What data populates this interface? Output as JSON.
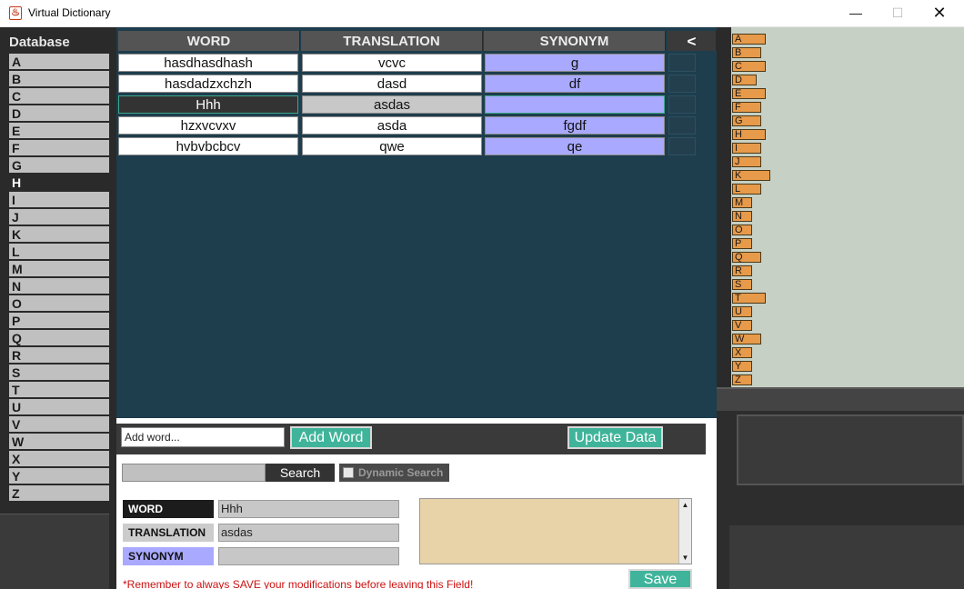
{
  "window": {
    "title": "Virtual Dictionary",
    "min": "—",
    "max": "☐",
    "close": "✕"
  },
  "database": {
    "header": "Database",
    "letters": [
      "A",
      "B",
      "C",
      "D",
      "E",
      "F",
      "G",
      "H",
      "I",
      "J",
      "K",
      "L",
      "M",
      "N",
      "O",
      "P",
      "Q",
      "R",
      "S",
      "T",
      "U",
      "V",
      "W",
      "X",
      "Y",
      "Z"
    ],
    "active_letter": "H"
  },
  "table": {
    "columns": [
      "WORD",
      "TRANSLATION",
      "SYNONYM"
    ],
    "back_label": "<",
    "rows": [
      {
        "word": "hasdhasdhash",
        "translation": "vcvc",
        "synonym": "g"
      },
      {
        "word": "hasdadzxchzh",
        "translation": "dasd",
        "synonym": "df"
      },
      {
        "word": "Hhh",
        "translation": "asdas",
        "synonym": ""
      },
      {
        "word": "hzxvcvxv",
        "translation": "asda",
        "synonym": "fgdf"
      },
      {
        "word": "hvbvbcbcv",
        "translation": "qwe",
        "synonym": "qe"
      }
    ],
    "selected_row": 2
  },
  "add_word": {
    "placeholder": "Add word...",
    "button": "Add Word",
    "update_button": "Update Data"
  },
  "search": {
    "value": "",
    "button": "Search",
    "dynamic_label": "Dynamic Search",
    "dynamic_checked": false
  },
  "detail": {
    "word_label": "WORD",
    "word_value": "Hhh",
    "translation_label": "TRANSLATION",
    "translation_value": "asdas",
    "synonym_label": "SYNONYM",
    "synonym_value": "",
    "notes": "",
    "save_button": "Save",
    "reminder": "*Remember to always SAVE your modifications before leaving this Field!"
  },
  "alphabet": {
    "letters": [
      "A",
      "B",
      "C",
      "D",
      "E",
      "F",
      "G",
      "H",
      "I",
      "J",
      "K",
      "L",
      "M",
      "N",
      "O",
      "P",
      "Q",
      "R",
      "S",
      "T",
      "U",
      "V",
      "W",
      "X",
      "Y",
      "Z"
    ],
    "counts": [
      5,
      4,
      5,
      3,
      5,
      4,
      4,
      5,
      4,
      4,
      6,
      4,
      2,
      2,
      2,
      2,
      4,
      2,
      2,
      5,
      2,
      2,
      4,
      2,
      2,
      2
    ]
  },
  "colors": {
    "panel_dark": "#2a2a2a",
    "table_bg": "#1e3d4d",
    "synonym": "#a9a9ff",
    "button_green": "#3fb49a",
    "alpha_bar": "#e79a4a",
    "alpha_bg": "#c7d0c4"
  }
}
